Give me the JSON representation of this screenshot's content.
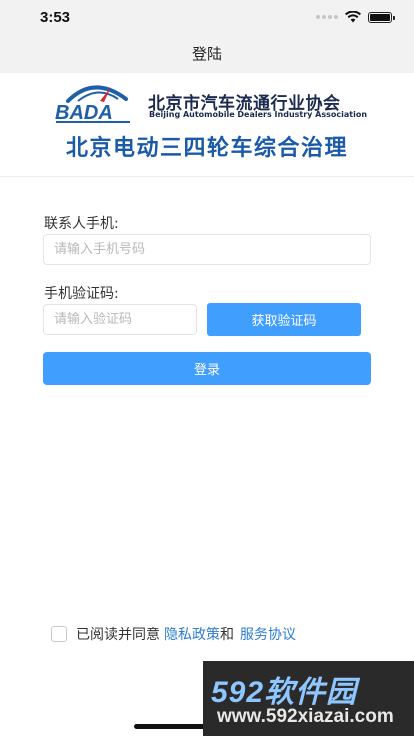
{
  "status_bar": {
    "time": "3:53"
  },
  "nav": {
    "title": "登陆"
  },
  "banner": {
    "logo_text": "BADA",
    "association_cn": "北京市汽车流通行业协会",
    "association_en": "Beijing Automobile Dealers Industry Association",
    "headline": "北京电动三四轮车综合治理"
  },
  "form": {
    "phone_label": "联系人手机:",
    "phone_placeholder": "请输入手机号码",
    "phone_value": "",
    "code_label": "手机验证码:",
    "code_placeholder": "请输入验证码",
    "code_value": "",
    "get_code_button": "获取验证码",
    "login_button": "登录"
  },
  "agreement": {
    "prefix": "已阅读并同意",
    "privacy": "隐私政策",
    "and": "和",
    "service": "服务协议",
    "checked": false
  },
  "watermark": {
    "brand": "592软件园",
    "url": "www.592xiazai.com"
  },
  "colors": {
    "primary": "#409eff",
    "headline": "#1a5aa8",
    "link": "#2d7dd2",
    "logo_blue": "#1f5fa8",
    "logo_red": "#d6282e"
  }
}
